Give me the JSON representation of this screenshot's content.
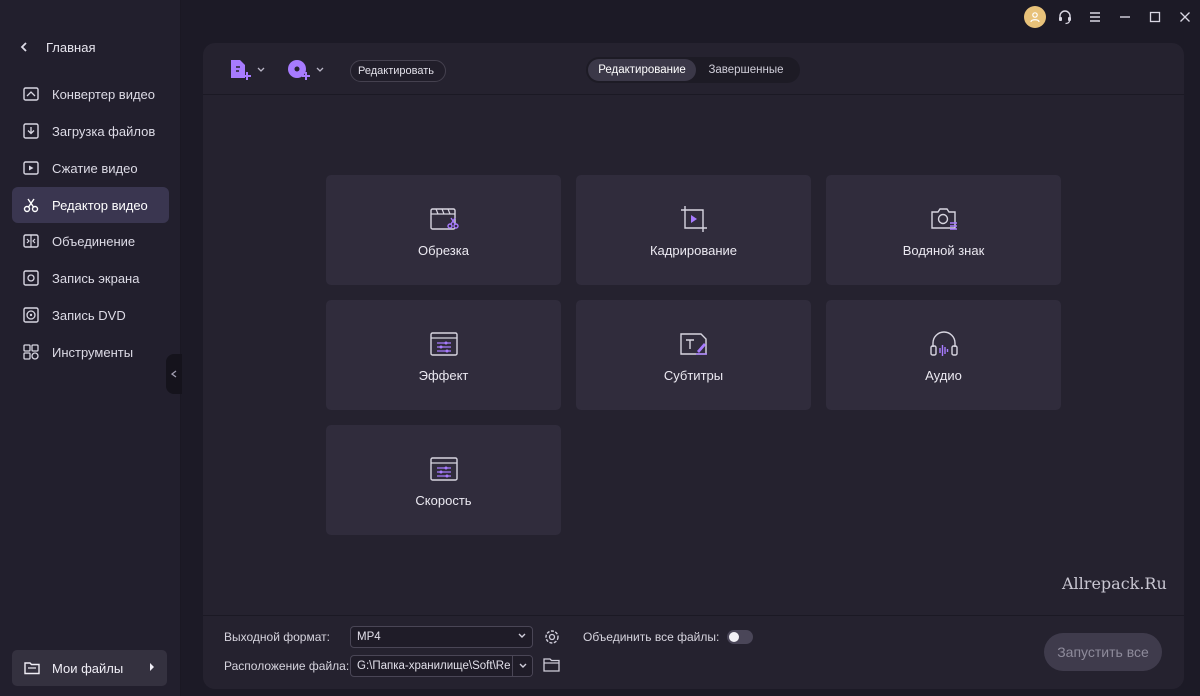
{
  "sidebar": {
    "home_label": "Главная",
    "items": [
      {
        "label": "Конвертер видео",
        "icon": "video-convert-icon"
      },
      {
        "label": "Загрузка файлов",
        "icon": "download-icon"
      },
      {
        "label": "Сжатие видео",
        "icon": "compress-icon"
      },
      {
        "label": "Редактор видео",
        "icon": "scissors-icon",
        "active": true
      },
      {
        "label": "Объединение",
        "icon": "merge-icon"
      },
      {
        "label": "Запись экрана",
        "icon": "screen-record-icon"
      },
      {
        "label": "Запись DVD",
        "icon": "dvd-icon"
      },
      {
        "label": "Инструменты",
        "icon": "toolbox-icon"
      }
    ],
    "my_files_label": "Мои файлы"
  },
  "toolbar": {
    "mode_select_value": "Редактировать",
    "tabs": [
      {
        "label": "Редактирование",
        "active": true
      },
      {
        "label": "Завершенные",
        "active": false
      }
    ]
  },
  "tools": [
    {
      "label": "Обрезка",
      "icon": "trim-icon"
    },
    {
      "label": "Кадрирование",
      "icon": "crop-icon"
    },
    {
      "label": "Водяной знак",
      "icon": "watermark-icon"
    },
    {
      "label": "Эффект",
      "icon": "effect-icon"
    },
    {
      "label": "Субтитры",
      "icon": "subtitles-icon"
    },
    {
      "label": "Аудио",
      "icon": "audio-icon"
    },
    {
      "label": "Скорость",
      "icon": "speed-icon"
    }
  ],
  "footer": {
    "output_format_label": "Выходной формат:",
    "output_format_value": "MP4",
    "merge_all_label": "Объединить все файлы:",
    "merge_all_on": false,
    "file_location_label": "Расположение файла:",
    "file_location_value": "G:\\Папка-хранилище\\Soft\\Re",
    "run_all_label": "Запустить все"
  },
  "watermark_text": "Allrepack.Ru",
  "colors": {
    "accent": "#a77bff",
    "background": "#1c1a26",
    "sidebar": "#221f2d",
    "panel": "#25222f",
    "card": "#302c3c",
    "active_nav": "#3a3650"
  }
}
